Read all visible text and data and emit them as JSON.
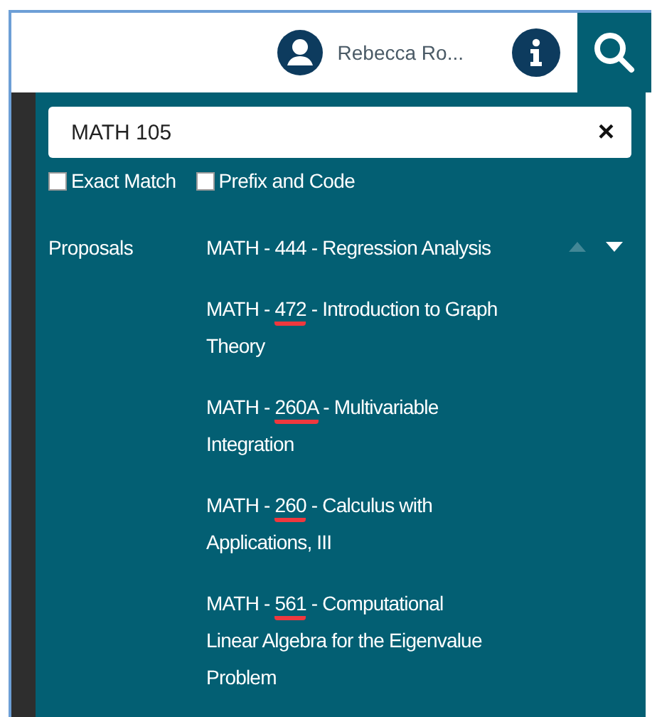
{
  "header": {
    "user_name": "Rebecca Ro...",
    "search_tab": {
      "selected": true
    }
  },
  "search": {
    "value": "MATH 105",
    "clear": "×"
  },
  "options": [
    {
      "label": "Exact Match",
      "checked": false
    },
    {
      "label": "Prefix and Code",
      "checked": false
    }
  ],
  "proposals": {
    "label": "Proposals",
    "reorder": {
      "up_disabled": true,
      "down_disabled": false
    },
    "items": [
      {
        "before": "MATH - ",
        "code": "444",
        "after": " - Regression Analysis",
        "marked": false
      },
      {
        "before": "MATH - ",
        "code": "472",
        "after": " - Introduction to Graph Theory",
        "marked": true
      },
      {
        "before": "MATH - ",
        "code": "260A",
        "after": " - Multivariable Integration",
        "marked": true
      },
      {
        "before": "MATH - ",
        "code": "260",
        "after": " - Calculus with Applications, III",
        "marked": true
      },
      {
        "before": "MATH - ",
        "code": "561",
        "after": " - Computational Linear Algebra for the Eigenvalue Problem",
        "marked": true
      }
    ]
  }
}
